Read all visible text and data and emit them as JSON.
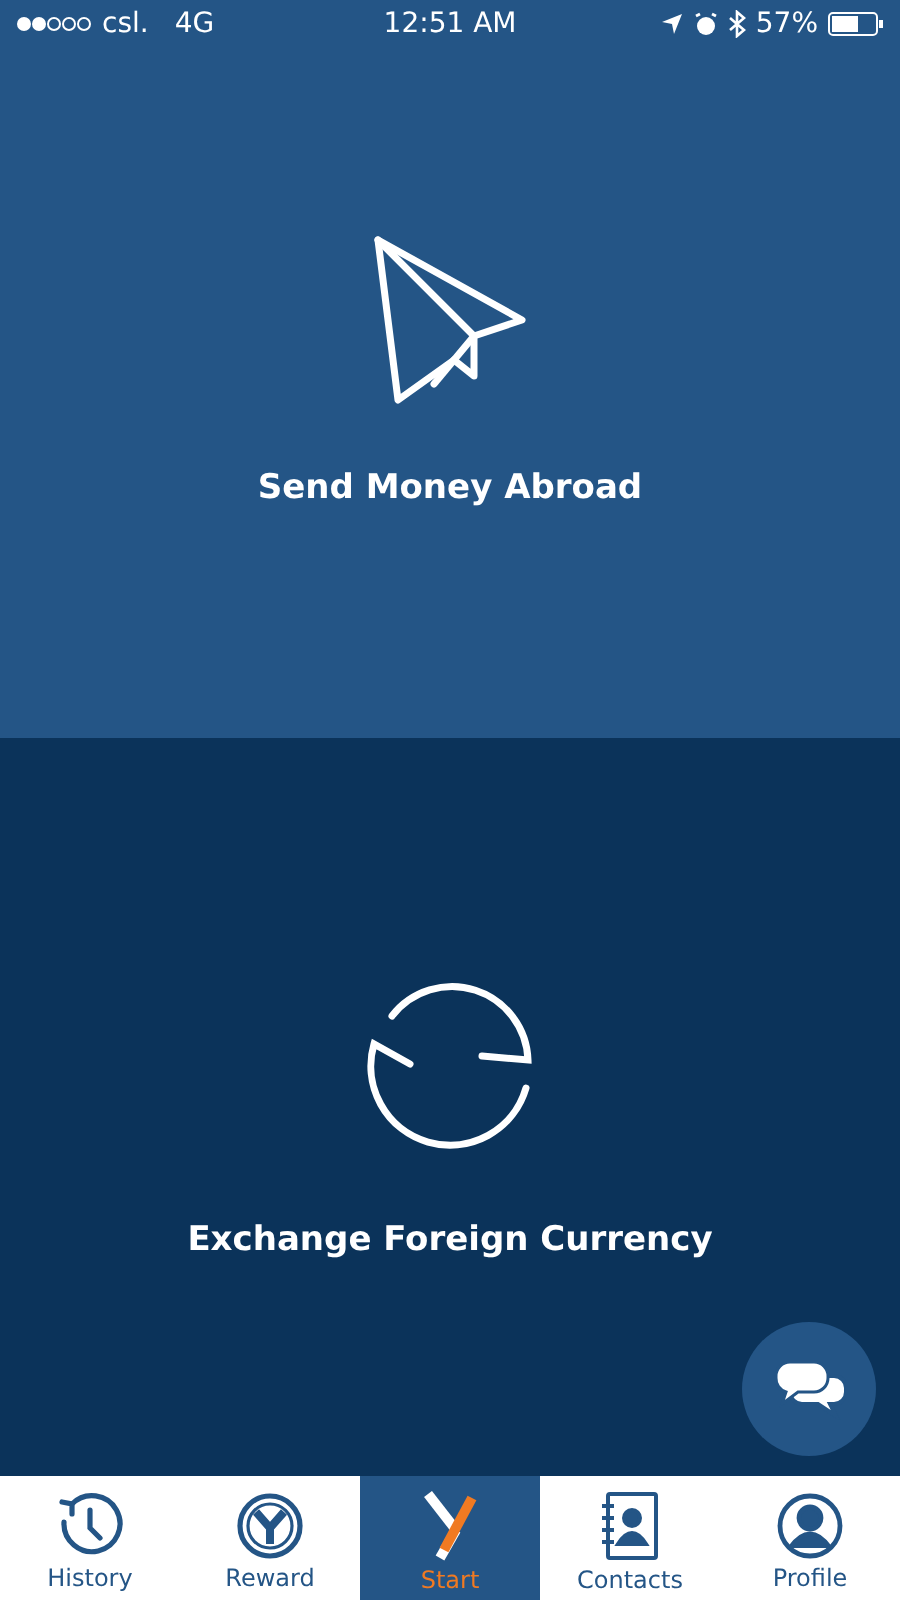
{
  "status_bar": {
    "carrier": "csl.",
    "network": "4G",
    "time": "12:51 AM",
    "battery": "57%"
  },
  "actions": [
    {
      "kind": "send",
      "label": "Send Money Abroad"
    },
    {
      "kind": "exchange",
      "label": "Exchange Foreign Currency"
    }
  ],
  "tabs": [
    {
      "kind": "history",
      "label": "History",
      "selected": false
    },
    {
      "kind": "reward",
      "label": "Reward",
      "selected": false
    },
    {
      "kind": "start",
      "label": "Start",
      "selected": true
    },
    {
      "kind": "contacts",
      "label": "Contacts",
      "selected": false
    },
    {
      "kind": "profile",
      "label": "Profile",
      "selected": false
    }
  ]
}
